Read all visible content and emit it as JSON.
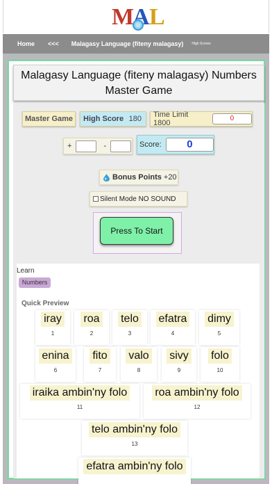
{
  "header": {
    "logo_letters": [
      "M",
      "A",
      "L"
    ]
  },
  "nav": {
    "home": "Home",
    "back": "<<<",
    "language": "Malagasy Language (fiteny malagasy)",
    "high_scores": "High Scores"
  },
  "page": {
    "title": "Malagasy Language (fiteny malagasy) Numbers Master Game"
  },
  "game": {
    "mode_label": "Master Game",
    "high_score_label": "High Score",
    "high_score_value": "180",
    "time_limit_label": "Time Limit 1800",
    "timer_value": "0",
    "operand_plus": "+",
    "operand_minus": "-",
    "score_label": "Score:",
    "score_value": "0",
    "bonus_label": "Bonus Points",
    "bonus_value": "+20",
    "silent_mode_label": "Silent Mode NO SOUND",
    "start_button": "Press To Start"
  },
  "learn": {
    "title": "Learn",
    "tag": "Numbers",
    "preview_title": "Quick Preview",
    "cards": [
      {
        "word": "iray",
        "num": "1"
      },
      {
        "word": "roa",
        "num": "2"
      },
      {
        "word": "telo",
        "num": "3"
      },
      {
        "word": "efatra",
        "num": "4"
      },
      {
        "word": "dimy",
        "num": "5"
      },
      {
        "word": "enina",
        "num": "6"
      },
      {
        "word": "fito",
        "num": "7"
      },
      {
        "word": "valo",
        "num": "8"
      },
      {
        "word": "sivy",
        "num": "9"
      },
      {
        "word": "folo",
        "num": "10"
      },
      {
        "word": "iraika ambin'ny folo",
        "num": "11"
      },
      {
        "word": "roa ambin'ny folo",
        "num": "12"
      },
      {
        "word": "telo ambin'ny folo",
        "num": "13"
      },
      {
        "word": "efatra ambin'ny folo",
        "num": ""
      }
    ]
  },
  "colors": {
    "nav_bg": "#8c8c8c",
    "frame_border": "#7fd6a0",
    "start_button": "#7ff0a8",
    "score_value": "#1f3fd8",
    "timer_value": "#e02020"
  }
}
